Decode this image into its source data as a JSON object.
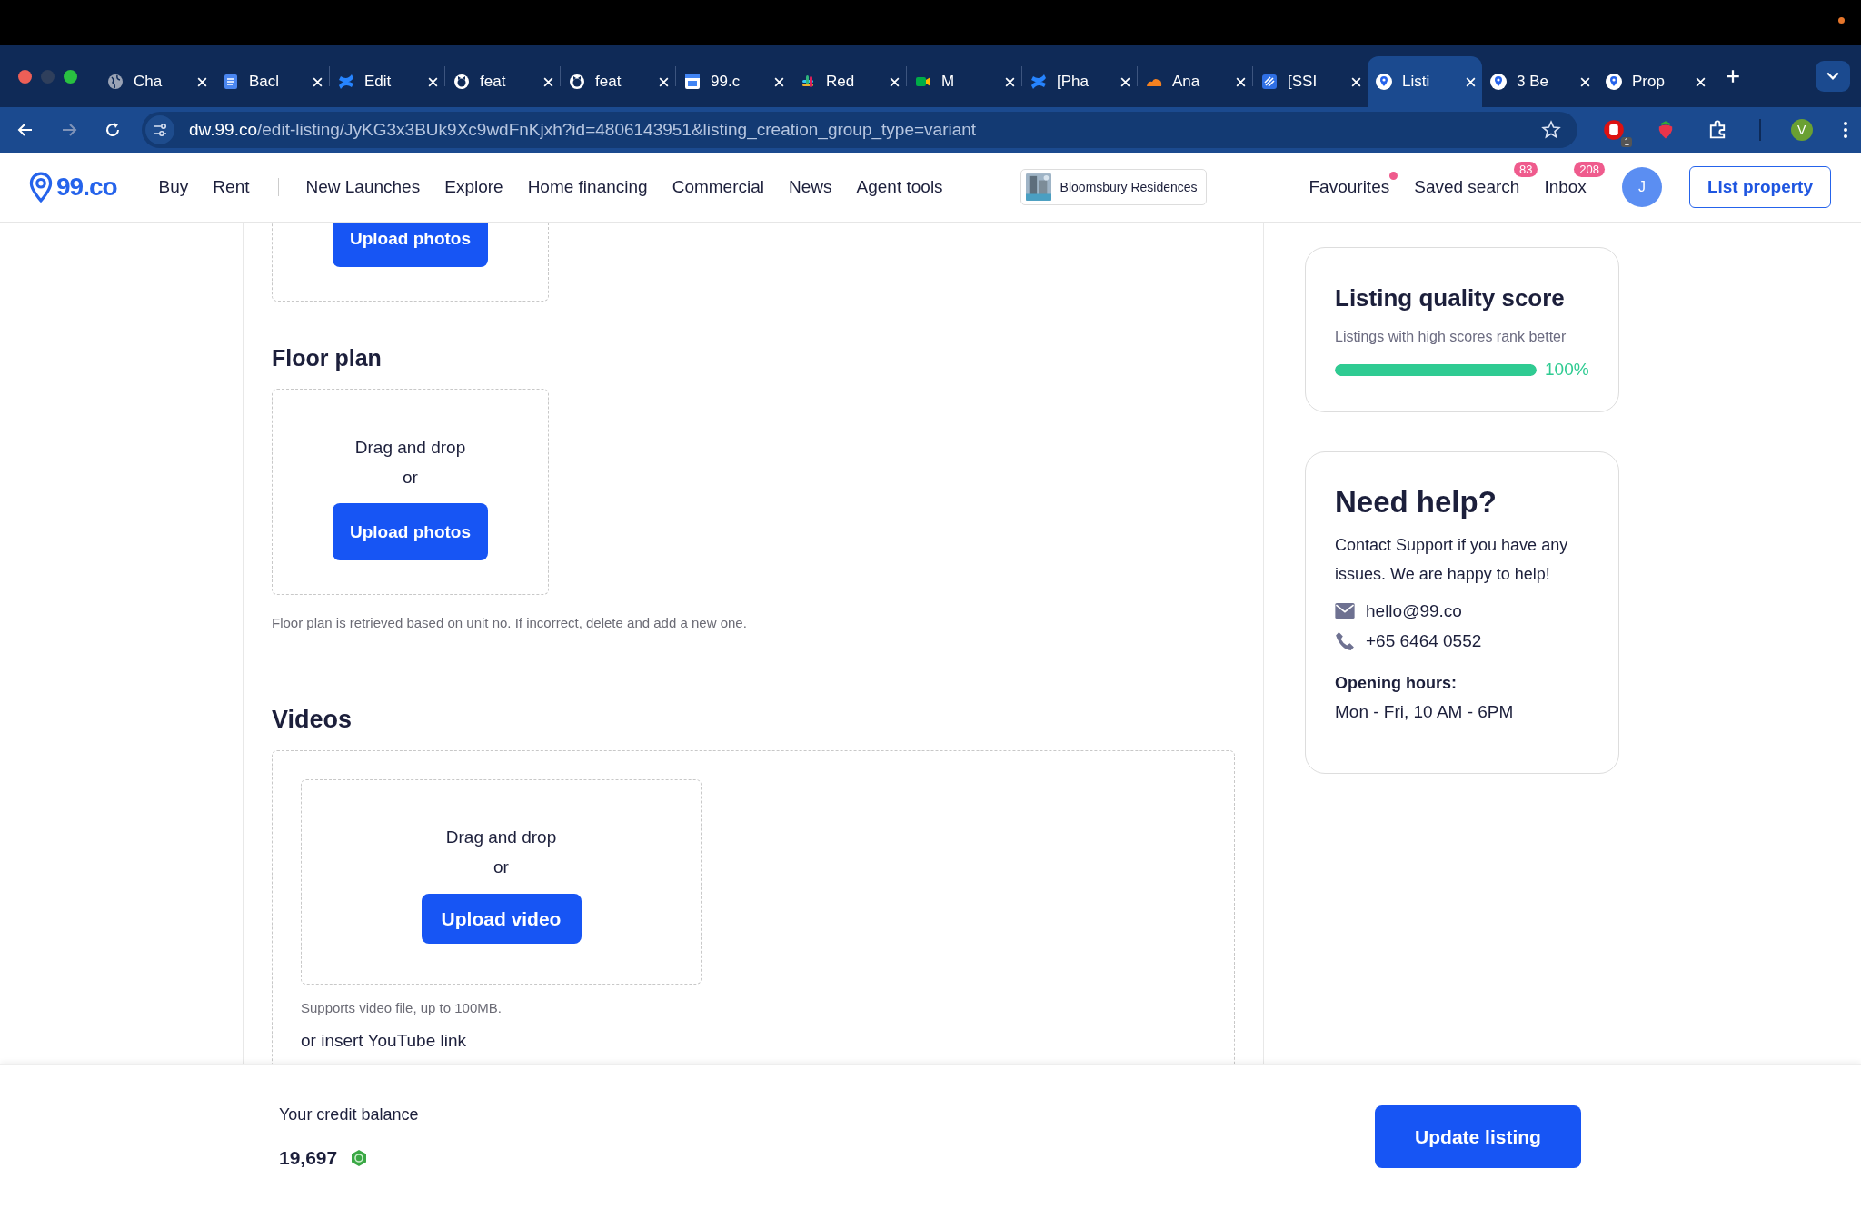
{
  "browser": {
    "tabs": [
      {
        "kind": "globe",
        "title": "Cha",
        "selected": false
      },
      {
        "kind": "doc",
        "title": "Bacl",
        "selected": false
      },
      {
        "kind": "confluence",
        "title": "Edit",
        "selected": false
      },
      {
        "kind": "github",
        "title": "feat",
        "selected": false
      },
      {
        "kind": "github",
        "title": "feat",
        "selected": false
      },
      {
        "kind": "calendar",
        "title": "99.c",
        "selected": false
      },
      {
        "kind": "slack",
        "title": "Red",
        "selected": false
      },
      {
        "kind": "meet",
        "title": "M",
        "selected": false
      },
      {
        "kind": "confluence",
        "title": "[Pha",
        "selected": false
      },
      {
        "kind": "cloud",
        "title": "Ana",
        "selected": false
      },
      {
        "kind": "jira",
        "title": "[SSI",
        "selected": false
      },
      {
        "kind": "pin",
        "title": "Listi",
        "selected": true
      },
      {
        "kind": "pin",
        "title": "3 Be",
        "selected": false
      },
      {
        "kind": "pin",
        "title": "Prop",
        "selected": false
      }
    ],
    "url": {
      "host": "dw.99.co",
      "path": "/edit-listing/JyKG3x3BUk9Xc9wdFnKjxh?id=4806143951&listing_creation_group_type=variant"
    },
    "extension_badge": "1",
    "profile_initial": "V"
  },
  "nav": {
    "logo": "99.co",
    "primary_links": [
      "Buy",
      "Rent"
    ],
    "links": [
      "New Launches",
      "Explore",
      "Home financing",
      "Commercial",
      "News",
      "Agent tools"
    ],
    "project_chip": "Bloomsbury Residences",
    "favourites": {
      "label": "Favourites",
      "has_notification": true
    },
    "saved_search": {
      "label": "Saved search",
      "badge": "83"
    },
    "inbox": {
      "label": "Inbox",
      "badge": "208"
    },
    "avatar": "J",
    "list_button": "List property"
  },
  "photos": {
    "button": "Upload photos"
  },
  "floor_plan": {
    "title": "Floor plan",
    "drop_text": "Drag and drop",
    "or_text": "or",
    "button": "Upload photos",
    "note": "Floor plan is retrieved based on unit no. If incorrect, delete and add a new one."
  },
  "videos": {
    "title": "Videos",
    "drop_text": "Drag and drop",
    "or_text": "or",
    "button": "Upload video",
    "hint": "Supports video file, up to 100MB.",
    "youtube_label": "or insert YouTube link"
  },
  "quality": {
    "title": "Listing quality score",
    "subtitle": "Listings with high scores rank better",
    "level": 1,
    "reading": "100%"
  },
  "help": {
    "title": "Need help?",
    "text": "Contact Support if you have any issues. We are happy to help!",
    "email": "hello@99.co",
    "phone": "+65 6464 0552",
    "hours_label": "Opening hours:",
    "hours": "Mon - Fri, 10 AM - 6PM"
  },
  "footer": {
    "credit_label": "Your credit balance",
    "credit_value": "19,697",
    "button": "Update listing"
  }
}
